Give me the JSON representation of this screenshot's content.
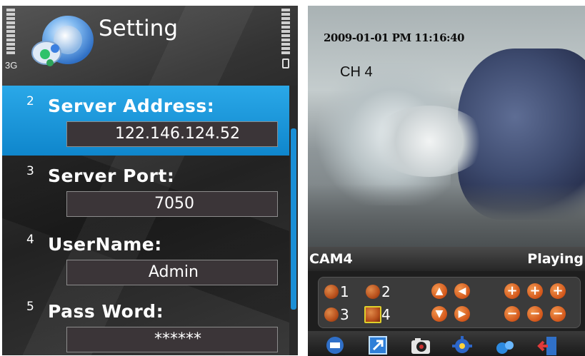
{
  "settings_screen": {
    "title": "Setting",
    "network_label": "3G",
    "fields": [
      {
        "index": "2",
        "label": "Server Address:",
        "value": "122.146.124.52",
        "selected": true
      },
      {
        "index": "3",
        "label": "Server Port:",
        "value": "7050",
        "selected": false
      },
      {
        "index": "4",
        "label": "UserName:",
        "value": "Admin",
        "selected": false
      },
      {
        "index": "5",
        "label": "Pass Word:",
        "value": "******",
        "selected": false
      }
    ]
  },
  "viewer_screen": {
    "timestamp": "2009-01-01 PM 11:16:40",
    "channel": "CH 4",
    "camera_label": "CAM4",
    "play_state": "Playing",
    "camera_buttons": [
      "1",
      "2",
      "3",
      "4"
    ],
    "active_camera": "4",
    "ptz_buttons": {
      "up": "▲",
      "left": "◀",
      "down": "▼",
      "right": "▶"
    },
    "zoom_buttons": {
      "plus": "+",
      "minus": "−"
    },
    "toolbar_icons": [
      "stop-icon",
      "fullscreen-icon",
      "snapshot-icon",
      "settings-icon",
      "search-icon",
      "exit-icon"
    ]
  },
  "colors": {
    "selection_blue": "#1a96dc",
    "field_bg": "#3b3538",
    "camera_button_orange": "#c9601e",
    "active_camera_border": "#e0d02a"
  }
}
